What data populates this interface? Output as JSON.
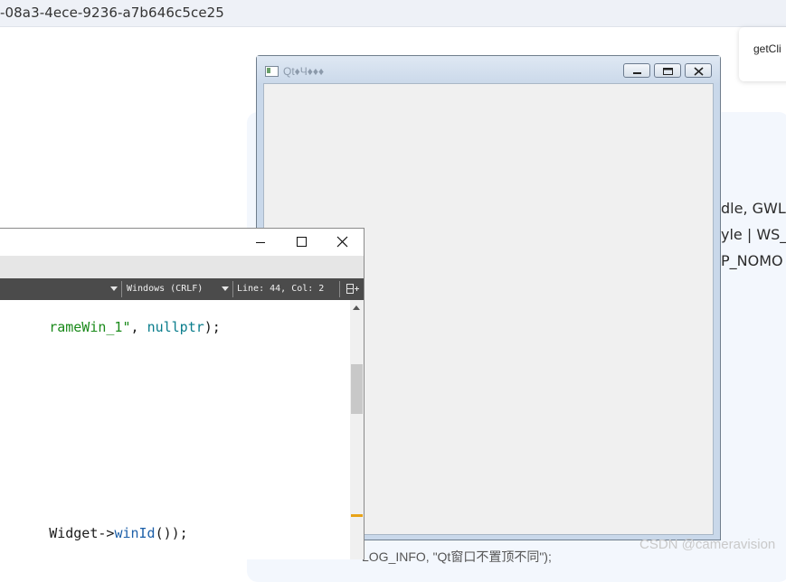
{
  "browser": {
    "guid_fragment": "-08a3-4ece-9236-a7b646c5ce25"
  },
  "float_card": {
    "label": "getCli"
  },
  "background_page": {
    "lines": [
      "dle, GWL",
      "yle | WS_(",
      "P_NOMO"
    ],
    "bottom_text": "  LOG_INFO, \"Qt窗口不置顶不同\");",
    "watermark": "CSDN @cameravision"
  },
  "qt_window": {
    "title": "Qt\u0004\u0004\u0004\u0004",
    "title_display": "Qt♦Ч♦♦♦",
    "buttons": [
      "minimize",
      "restore",
      "close"
    ]
  },
  "editor": {
    "statusbar": {
      "line_endings": "Windows (CRLF)",
      "position": "Line: 44, Col: 2"
    },
    "code_lines": [
      {
        "parts": [
          {
            "t": "rameWin_1\"",
            "c": "str"
          },
          {
            "t": ", ",
            "c": "plain"
          },
          {
            "t": "nullptr",
            "c": "kw"
          },
          {
            "t": ");",
            "c": "plain"
          }
        ]
      },
      {
        "parts": [
          {
            "t": "Widget->",
            "c": "plain"
          },
          {
            "t": "winId",
            "c": "fn"
          },
          {
            "t": "());",
            "c": "plain"
          }
        ]
      }
    ]
  },
  "colors": {
    "qt_frame": "#c9d8ea",
    "editor_status": "#4b4b4b",
    "scroll_marker": "#e8a317",
    "string": "#1a8a1a",
    "keyword": "#0a7d8c"
  }
}
